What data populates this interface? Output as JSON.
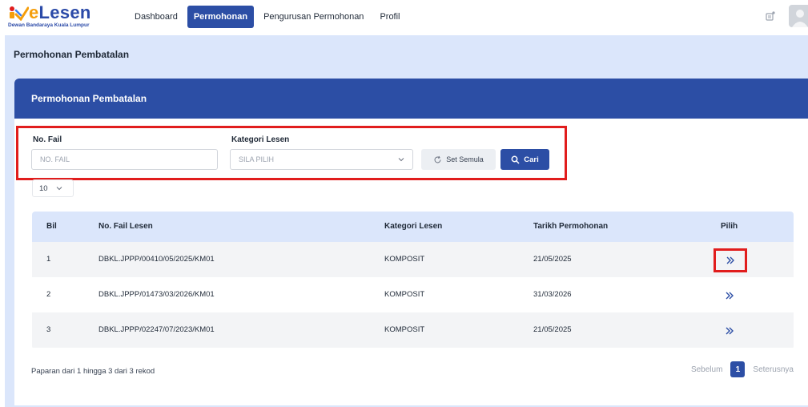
{
  "brand": {
    "name_prefix": "e",
    "name_rest": "Lesen",
    "subtitle": "Dewan Bandaraya Kuala Lumpur"
  },
  "nav": {
    "items": [
      {
        "label": "Dashboard"
      },
      {
        "label": "Permohonan"
      },
      {
        "label": "Pengurusan Permohonan"
      },
      {
        "label": "Profil"
      }
    ],
    "active": "Permohonan"
  },
  "page": {
    "title": "Permohonan Pembatalan"
  },
  "card": {
    "title": "Permohonan Pembatalan"
  },
  "filters": {
    "no_fail_label": "No. Fail",
    "no_fail_placeholder": "NO. FAIL",
    "kategori_label": "Kategori Lesen",
    "kategori_placeholder": "SILA PILIH",
    "reset_label": "Set Semula",
    "search_label": "Cari"
  },
  "per_page": "10",
  "table": {
    "headers": [
      "Bil",
      "No. Fail Lesen",
      "Kategori Lesen",
      "Tarikh Permohonan",
      "Pilih"
    ],
    "rows": [
      {
        "bil": "1",
        "no_fail": "DBKL.JPPP/00410/05/2025/KM01",
        "kategori": "KOMPOSIT",
        "tarikh": "21/05/2025"
      },
      {
        "bil": "2",
        "no_fail": "DBKL.JPPP/01473/03/2026/KM01",
        "kategori": "KOMPOSIT",
        "tarikh": "31/03/2026"
      },
      {
        "bil": "3",
        "no_fail": "DBKL.JPPP/02247/07/2023/KM01",
        "kategori": "KOMPOSIT",
        "tarikh": "21/05/2025"
      }
    ]
  },
  "footer": {
    "info": "Paparan dari 1 hingga 3 dari 3 rekod",
    "prev_label": "Sebelum",
    "current_page": "1",
    "next_label": "Seterusnya"
  },
  "colors": {
    "primary": "#2c4ea5",
    "band": "#dbe6fb",
    "highlight": "#e11d1d"
  },
  "icons": [
    "bell-icon",
    "avatar-icon",
    "refresh-icon",
    "search-icon",
    "chevron-down-icon",
    "chevron-right-double-icon"
  ]
}
